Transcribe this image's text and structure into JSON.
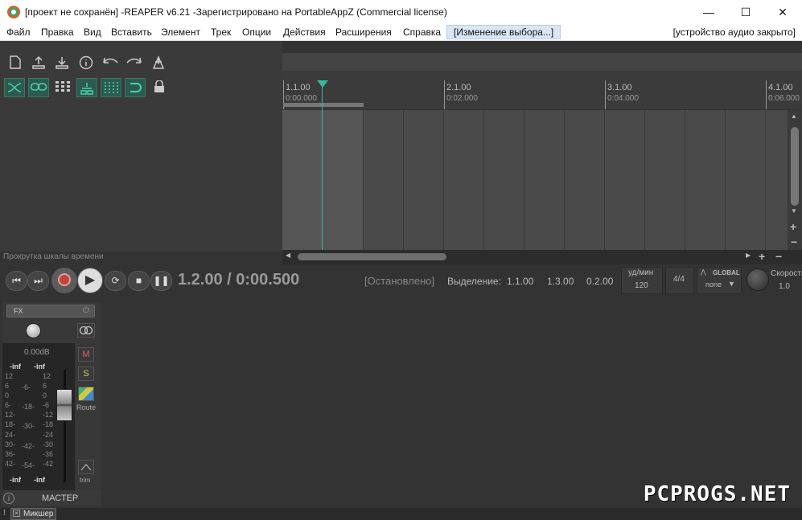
{
  "window": {
    "title": "[проект не сохранён] -REAPER v6.21 -Зарегистрировано на PortableAppZ (Commercial license)",
    "minimize": "—",
    "maximize": "☐",
    "close": "✕"
  },
  "menu": {
    "items": [
      "Файл",
      "Правка",
      "Вид",
      "Вставить",
      "Элемент",
      "Трек",
      "Опции",
      "Действия",
      "Расширения",
      "Справка"
    ],
    "highlight": "[Изменение выбора...]",
    "audio_status": "[устройство аудио закрыто]"
  },
  "toolbar": {
    "icons": [
      "new-project-icon",
      "save-icon",
      "import-icon",
      "info-icon",
      "undo-icon",
      "redo-icon",
      "metronome-icon",
      "ripple-icon",
      "link-icon",
      "grid-icon",
      "group-icon",
      "snap-icon",
      "loop-icon",
      "lock-icon"
    ]
  },
  "timeline": {
    "scroll_label": "Прокрутка шкалы времени",
    "bars": [
      {
        "label": "1.1.00",
        "time": "0:00.000"
      },
      {
        "label": "2.1.00",
        "time": "0:02.000"
      },
      {
        "label": "3.1.00",
        "time": "0:04.000"
      },
      {
        "label": "4.1.00",
        "time": "0:06.000"
      }
    ]
  },
  "transport": {
    "position": "1.2.00 / 0:00.500",
    "status": "[Остановлено]",
    "selection_label": "Выделение:",
    "sel_start": "1.1.00",
    "sel_end": "1.3.00",
    "sel_length": "0.2.00",
    "bpm_label": "уд/мин",
    "bpm": "120",
    "time_sig": "4/4",
    "global_label": "GLOBAL",
    "global_value": "none",
    "rate_label": "Скорость",
    "rate": "1.0"
  },
  "mixer": {
    "fx_label": "FX",
    "db": "0.00dB",
    "inf": "-inf",
    "scale_left": [
      "12",
      "6",
      "0",
      "6-",
      "12-",
      "18-",
      "24-",
      "30-",
      "36-",
      "42-"
    ],
    "scale_mid": [
      "-6-",
      "-18-",
      "-30-",
      "-42-",
      "-54-"
    ],
    "scale_right": [
      "12",
      "6",
      "0",
      "-6",
      "-12",
      "-18",
      "-24",
      "-30",
      "-36",
      "-42"
    ],
    "mute": "M",
    "solo": "S",
    "route": "Route",
    "trim": "trim",
    "master": "МАСТЕР",
    "tab": "Микшер"
  },
  "watermark": "PCPROGS.NET"
}
